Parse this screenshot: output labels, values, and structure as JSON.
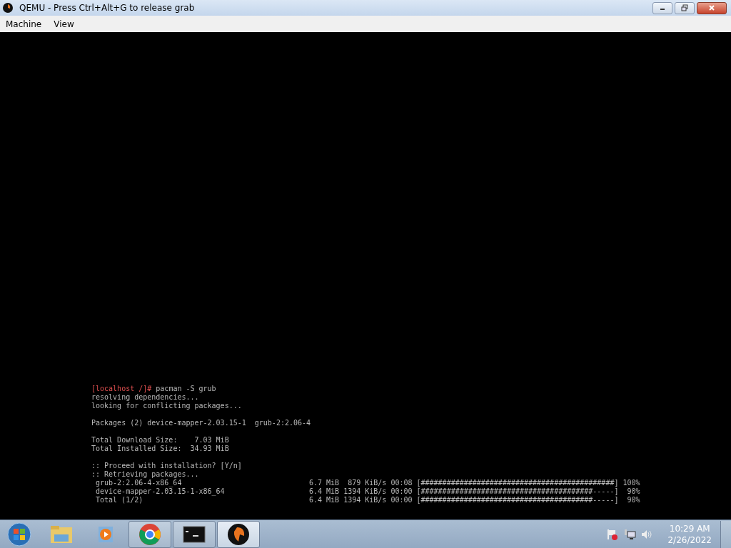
{
  "window": {
    "title": "QEMU - Press Ctrl+Alt+G to release grab"
  },
  "menu": [
    "Machine",
    "View"
  ],
  "terminal": {
    "lines": [
      {
        "kind": "prompt",
        "prompt": "[localhost /]#",
        "command": "pacman -S grub"
      },
      {
        "kind": "text",
        "text": "resolving dependencies..."
      },
      {
        "kind": "text",
        "text": "looking for conflicting packages..."
      },
      {
        "kind": "blank"
      },
      {
        "kind": "text",
        "text": "Packages (2) device-mapper-2.03.15-1  grub-2:2.06-4"
      },
      {
        "kind": "blank"
      },
      {
        "kind": "text",
        "text": "Total Download Size:    7.03 MiB"
      },
      {
        "kind": "text",
        "text": "Total Installed Size:  34.93 MiB"
      },
      {
        "kind": "blank"
      },
      {
        "kind": "text",
        "text": ":: Proceed with installation? [Y/n]"
      },
      {
        "kind": "text",
        "text": ":: Retrieving packages..."
      }
    ],
    "downloads": [
      {
        "name": "grub-2:2.06-4-x86_64",
        "size": "6.7 MiB",
        "rate": "879 KiB/s",
        "time": "00:08",
        "bar": "[#############################################]",
        "percent": "100%"
      },
      {
        "name": "device-mapper-2.03.15-1-x86_64",
        "size": "6.4 MiB",
        "rate": "1394 KiB/s",
        "time": "00:00",
        "bar": "[########################################-----]",
        "percent": "90%"
      },
      {
        "name": "Total (1/2)",
        "size": "6.4 MiB",
        "rate": "1394 KiB/s",
        "time": "00:00",
        "bar": "[########################################-----]",
        "percent": "90%"
      }
    ]
  },
  "taskbar": {
    "items": [
      {
        "kind": "folder",
        "running": false,
        "selected": false
      },
      {
        "kind": "media",
        "running": false,
        "selected": false
      },
      {
        "kind": "browser",
        "running": true,
        "selected": false
      },
      {
        "kind": "console",
        "running": true,
        "selected": false
      },
      {
        "kind": "qemu",
        "running": true,
        "selected": true
      }
    ],
    "clock": {
      "time": "10:29 AM",
      "date": "2/26/2022"
    }
  }
}
